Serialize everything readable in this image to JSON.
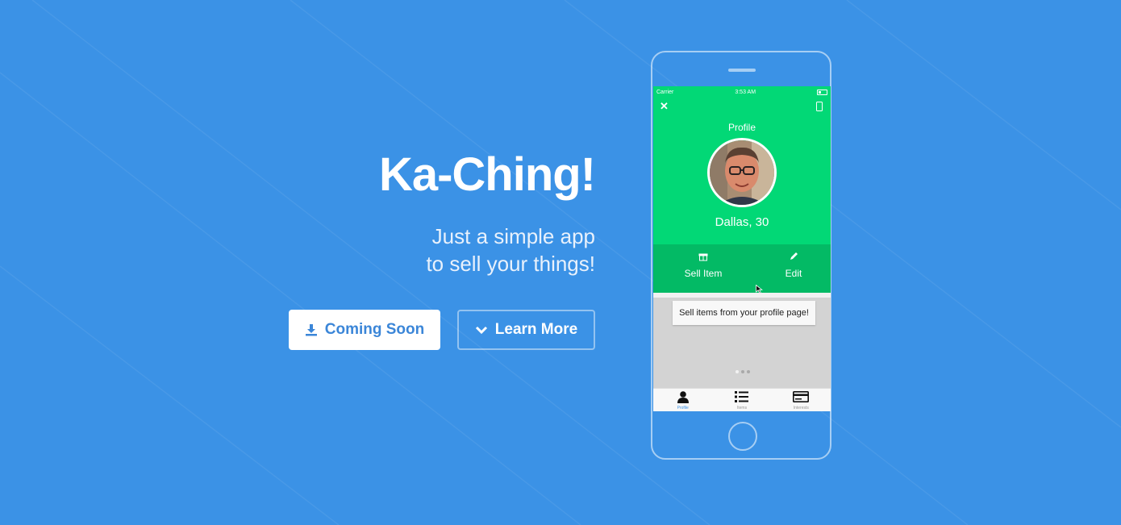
{
  "hero": {
    "title": "Ka-Ching!",
    "tagline_line1": "Just a simple app",
    "tagline_line2": "to sell your things!"
  },
  "buttons": {
    "primary_label": "Coming Soon",
    "primary_icon": "download-icon",
    "secondary_label": "Learn More",
    "secondary_icon": "chevron-down-icon"
  },
  "phone_screen": {
    "status_bar": {
      "carrier": "Carrier",
      "time": "3:53 AM"
    },
    "profile_title": "Profile",
    "profile_name": "Dallas, 30",
    "actions": [
      {
        "label": "Sell Item",
        "icon": "gift-icon"
      },
      {
        "label": "Edit",
        "icon": "pencil-icon"
      }
    ],
    "tooltip": "Sell items from your profile page!",
    "tabs": [
      {
        "label": "Profile",
        "icon": "person-icon",
        "active": true
      },
      {
        "label": "Items",
        "icon": "list-icon",
        "active": false
      },
      {
        "label": "Interests",
        "icon": "card-icon",
        "active": false
      }
    ]
  },
  "colors": {
    "background": "#3b92e6",
    "screen_green": "#02d876",
    "action_green": "#03ba65",
    "primary_button_text": "#3b86d8"
  }
}
